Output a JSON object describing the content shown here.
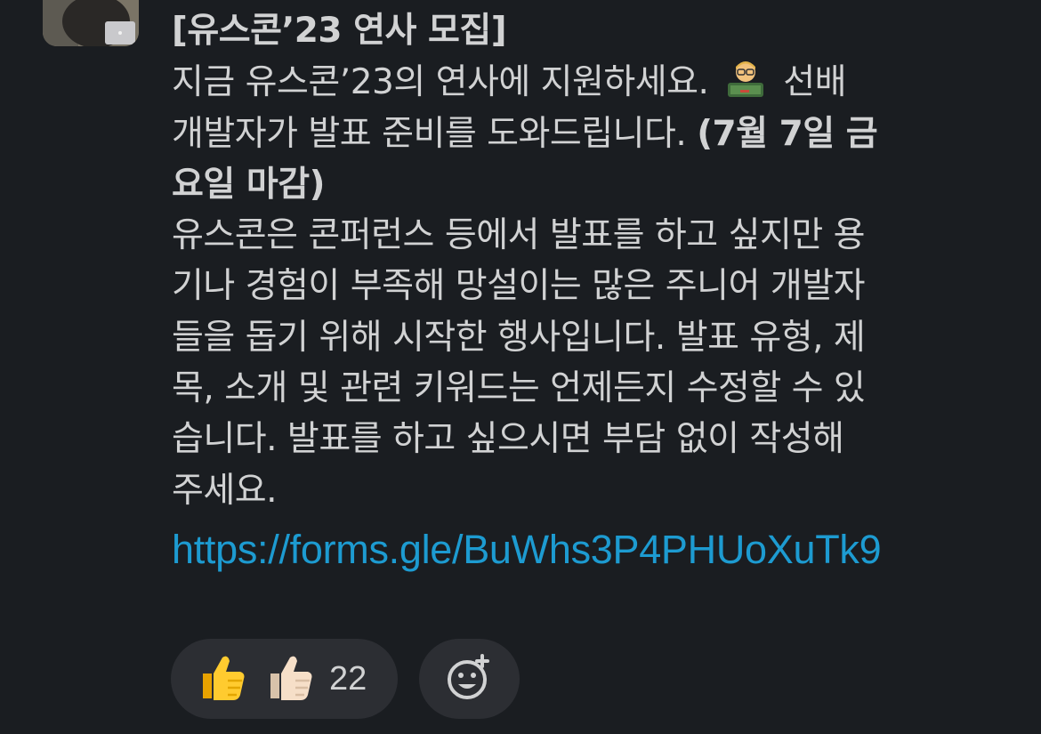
{
  "message": {
    "title": "[유스콘’23 연사 모집]",
    "intro_1": "지금 유스콘’23의 연사에 지원하세요.",
    "intro_2": "선배",
    "intro_3": "개발자가 발표 준비를 도와드립니다.",
    "deadline_1": "(7월 7일 금",
    "deadline_2": "요일 마감)",
    "body_lines": [
      "유스콘은 콘퍼런스 등에서 발표를 하고 싶지만 용",
      "기나 경험이 부족해 망설이는 많은 주니어 개발자",
      "들을 돕기 위해 시작한 행사입니다. 발표 유형, 제",
      "목, 소개 및 관련 키워드는 언제든지 수정할 수 있",
      "습니다. 발표를 하고 싶으시면 부담 없이 작성해",
      "주세요."
    ],
    "link": "https://forms.gle/BuWhs3P4PHUoXuTk9",
    "emoji": "teacher-emoji"
  },
  "reactions": {
    "thumbs_count": "22",
    "thumbs_icons": [
      "thumbs-up-yellow",
      "thumbs-up-light"
    ],
    "add_reaction_icon": "add-reaction-icon"
  },
  "colors": {
    "background": "#1a1d21",
    "text": "#d1d2d3",
    "link": "#1d9bd1",
    "pill": "#2c2e33"
  }
}
